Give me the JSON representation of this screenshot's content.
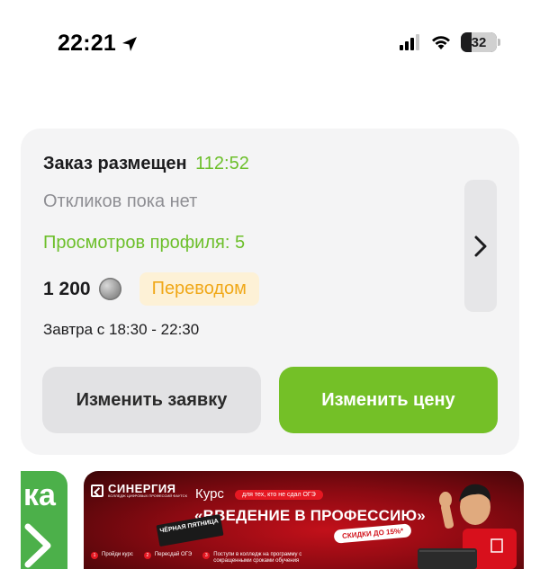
{
  "status_bar": {
    "time": "22:21",
    "battery": "32",
    "battery_level_percent": 32
  },
  "order": {
    "title": "Заказ размещен",
    "timer": "112:52",
    "responses": "Откликов пока нет",
    "profile_views": "Просмотров профиля: 5",
    "price": "1 200",
    "payment_method": "Переводом",
    "schedule": "Завтра с 18:30 - 22:30",
    "edit_button": "Изменить заявку",
    "change_price_button": "Изменить цену"
  },
  "promo_left": {
    "text": "ка"
  },
  "promo_banner": {
    "brand_name": "СИНЕРГИЯ",
    "brand_sub": "КОЛЛЕДЖ ЦИФРОВЫХ ПРОФЕССИЙ ФАУТСК",
    "course_label": "Курс",
    "audience": "для тех, кто не сдал ОГЭ",
    "course_title": "«ВВЕДЕНИЕ В ПРОФЕССИЮ»",
    "black_friday": "ЧЁРНАЯ ПЯТНИЦА",
    "discount": "СКИДКИ ДО 15%*",
    "steps": [
      {
        "num": "1",
        "text": "Пройди курс"
      },
      {
        "num": "2",
        "text": "Пересдай ОГЭ"
      },
      {
        "num": "3",
        "text": "Поступи в колледж на программу с сокращенными сроками обучения"
      }
    ]
  },
  "colors": {
    "accent_green": "#74c027",
    "timer_green": "#6cbf2a",
    "badge_orange": "#f0a818",
    "banner_red": "#c2101a"
  }
}
